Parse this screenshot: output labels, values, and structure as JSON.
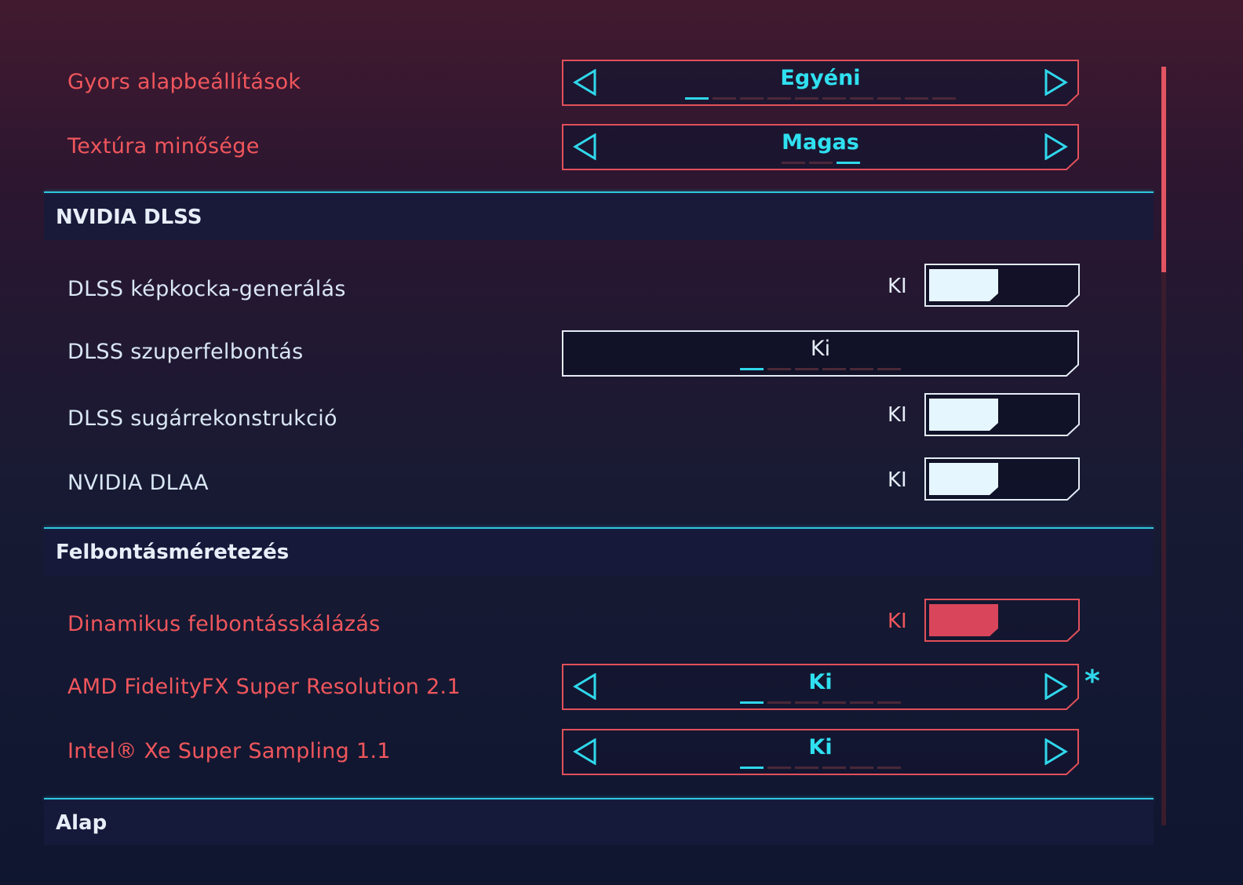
{
  "settings": {
    "quick_preset": {
      "label": "Gyors alapbeállítások",
      "value": "Egyéni"
    },
    "texture_quality": {
      "label": "Textúra minősége",
      "value": "Magas"
    }
  },
  "sections": {
    "dlss": {
      "title": "NVIDIA DLSS"
    },
    "resolution_scaling": {
      "title": "Felbontásméretezés"
    },
    "basic": {
      "title": "Alap"
    }
  },
  "dlss": {
    "frame_generation": {
      "label": "DLSS képkocka-generálás",
      "state": "KI"
    },
    "super_resolution": {
      "label": "DLSS szuperfelbontás",
      "value": "Ki"
    },
    "ray_reconstruction": {
      "label": "DLSS sugárrekonstrukció",
      "state": "KI"
    },
    "dlaa": {
      "label": "NVIDIA DLAA",
      "state": "KI"
    }
  },
  "scaling": {
    "dynamic_resolution": {
      "label": "Dinamikus felbontásskálázás",
      "state": "KI"
    },
    "fsr": {
      "label": "AMD FidelityFX Super Resolution 2.1",
      "value": "Ki",
      "marker": "*"
    },
    "xess": {
      "label": "Intel® Xe Super Sampling 1.1",
      "value": "Ki"
    }
  },
  "colors": {
    "accent_red": "#f0565c",
    "accent_cyan": "#2fd8ec",
    "toggle_fill_white": "#e6f6ff",
    "toggle_fill_red": "#d9455a"
  },
  "icons": {
    "arrow_left": "arrow-left-icon",
    "arrow_right": "arrow-right-icon"
  }
}
